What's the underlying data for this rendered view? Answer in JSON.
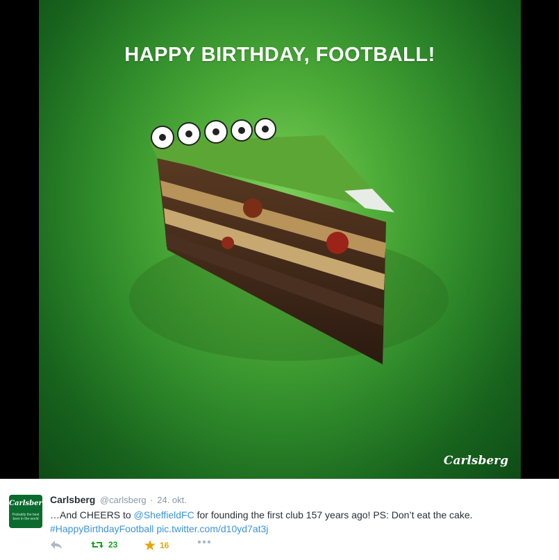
{
  "media": {
    "headline": "HAPPY BIRTHDAY, FOOTBALL!",
    "logo_text": "Carlsberg",
    "colors": {
      "pitch_green": "#3f9e34",
      "frame": "#000000"
    }
  },
  "tweet": {
    "avatar_logo": "Carlsberg",
    "avatar_tagline": "Probably the best beer in the world",
    "author_name": "Carlsberg",
    "handle": "@carlsberg",
    "separator": "·",
    "date": "24. okt.",
    "text_part1": "…And CHEERS to ",
    "mention": "@SheffieldFC",
    "text_part2": " for founding the first club 157 years ago! PS: Don’t eat the cake.",
    "hashtag": "#HappyBirthdayFootball",
    "pic_link": "pic.twitter.com/d10yd7at3j",
    "retweet_count": "23",
    "favorite_count": "16",
    "icons": {
      "reply": "reply-icon",
      "retweet": "retweet-icon",
      "favorite": "star-icon",
      "more": "more-icon"
    },
    "colors": {
      "link": "#3b94d9",
      "retweet": "#19a11f",
      "favorite": "#e8a40c",
      "muted": "#8899a6"
    }
  }
}
